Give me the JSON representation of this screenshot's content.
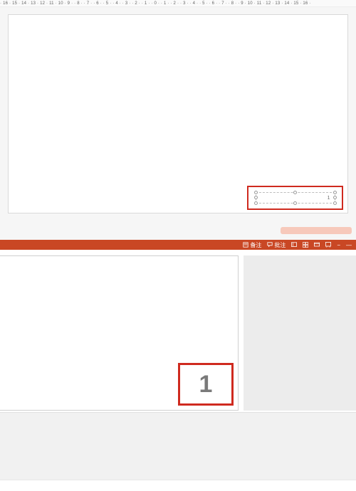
{
  "ruler": {
    "text": " · 16 · 15 · 14 · 13 · 12 · 11 · 10 · 9 · · 8 · · 7 · · 6 · · 5 · · 4 · · 3 · · 2 · · 1 · · 0 · · 1 · · 2 · · 3 · · 4 · · 5 · · 6 · · 7 · · 8 · · 9 · 10 · 11 · 12 · 13 · 14 · 15 · 16 · "
  },
  "canvas": {
    "page_number_placeholder_value": "1"
  },
  "statusbar": {
    "notes_label": "备注",
    "comments_label": "批注",
    "zoom_out": "−",
    "zoom_in": "—"
  },
  "preview": {
    "page_number": "1"
  }
}
